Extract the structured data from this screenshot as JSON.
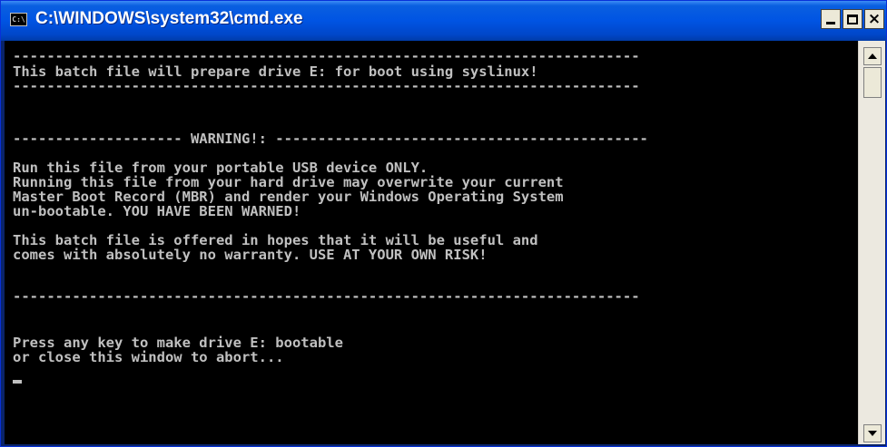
{
  "window": {
    "title": "C:\\WINDOWS\\system32\\cmd.exe",
    "icon_text": "C:\\",
    "controls": {
      "minimize": "minimize-icon",
      "maximize": "maximize-icon",
      "close": "×"
    }
  },
  "console": {
    "lines": [
      "--------------------------------------------------------------------------",
      "This batch file will prepare drive E: for boot using syslinux!",
      "--------------------------------------------------------------------------",
      "",
      "",
      "-------------------- WARNING!: --------------------------------------------",
      "",
      "Run this file from your portable USB device ONLY.",
      "Running this file from your hard drive may overwrite your current",
      "Master Boot Record (MBR) and render your Windows Operating System",
      "un-bootable. YOU HAVE BEEN WARNED!",
      "",
      "This batch file is offered in hopes that it will be useful and",
      "comes with absolutely no warranty. USE AT YOUR OWN RISK!",
      "",
      "--------------------------------------------------------------------------",
      "",
      "",
      "Press any key to make drive E: bootable",
      "or close this window to abort..."
    ]
  },
  "colors": {
    "titlebar": "#0054e3",
    "console_bg": "#000000",
    "console_text": "#c0c0c0"
  }
}
